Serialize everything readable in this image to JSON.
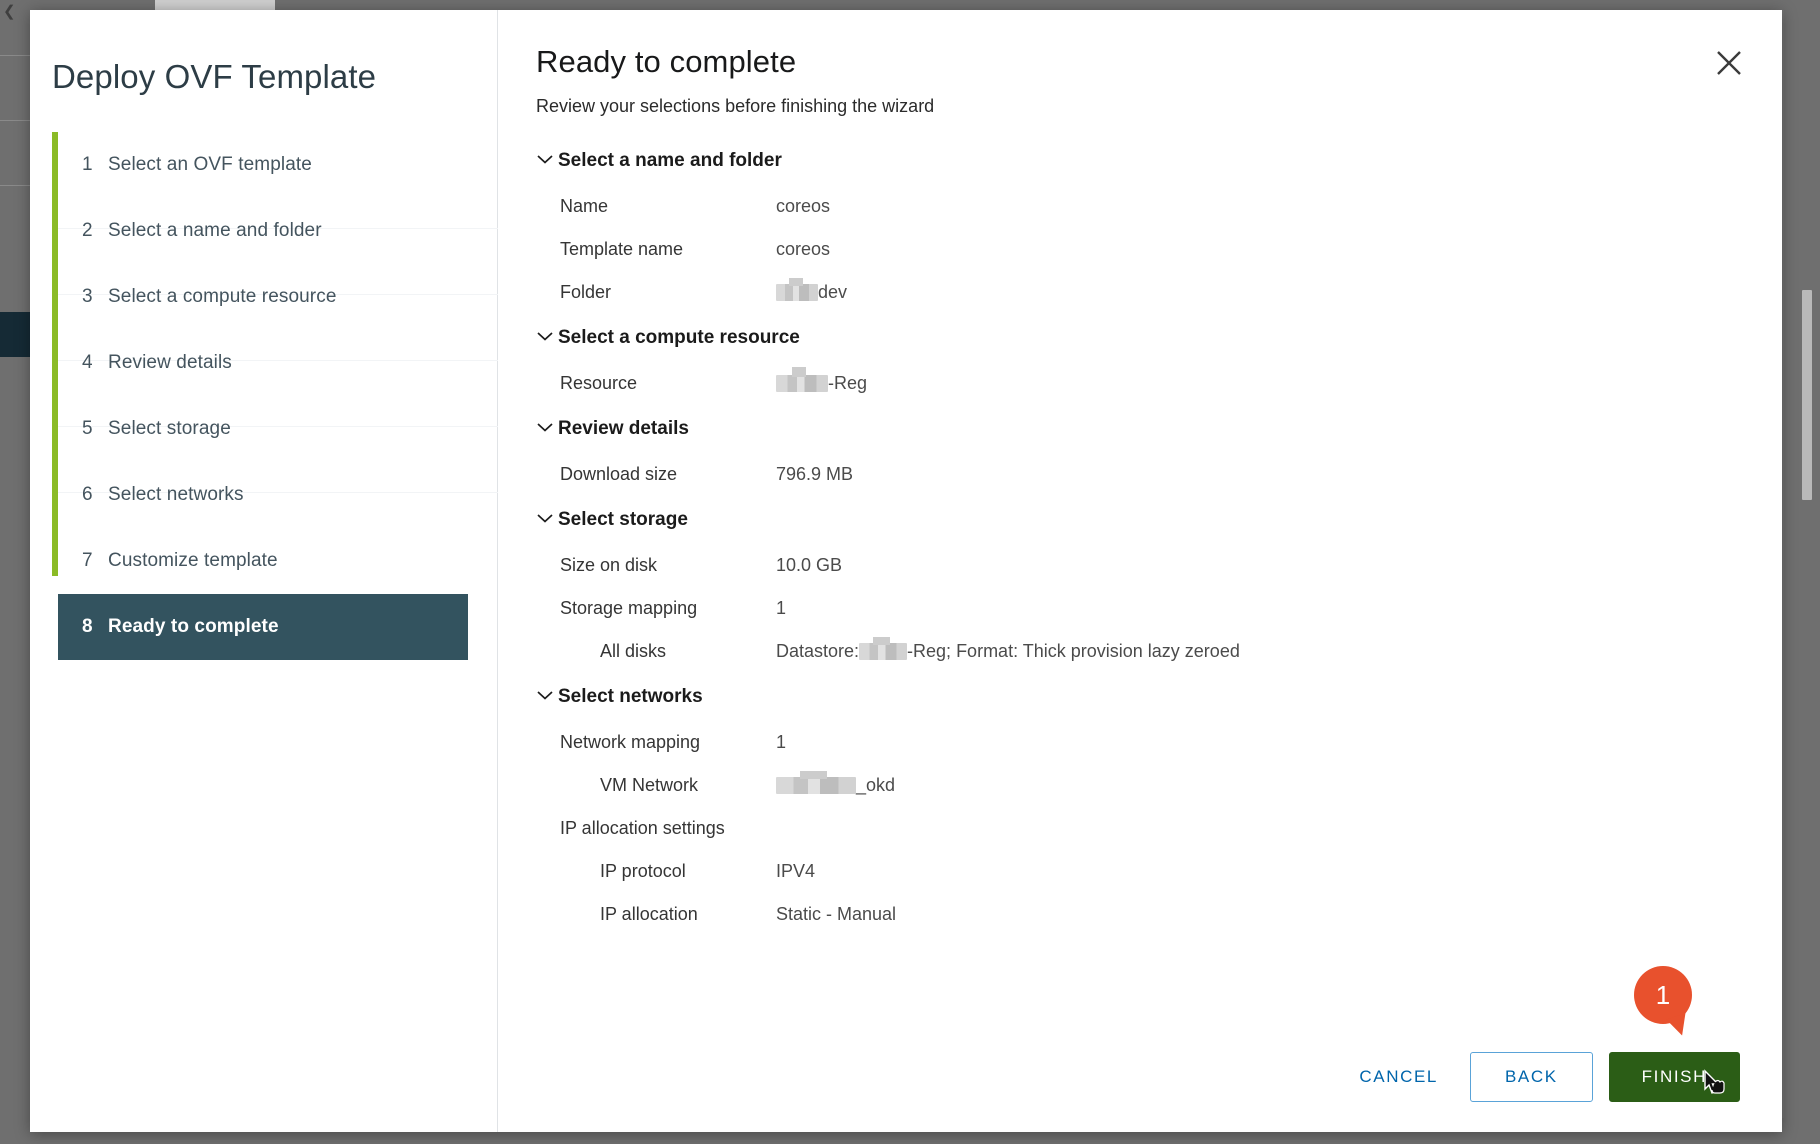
{
  "window": {
    "wizard_title": "Deploy OVF Template",
    "close_icon": "close-icon"
  },
  "sidebar": {
    "steps": [
      {
        "num": "1",
        "label": "Select an OVF template",
        "selected": false
      },
      {
        "num": "2",
        "label": "Select a name and folder",
        "selected": false
      },
      {
        "num": "3",
        "label": "Select a compute resource",
        "selected": false
      },
      {
        "num": "4",
        "label": "Review details",
        "selected": false
      },
      {
        "num": "5",
        "label": "Select storage",
        "selected": false
      },
      {
        "num": "6",
        "label": "Select networks",
        "selected": false
      },
      {
        "num": "7",
        "label": "Customize template",
        "selected": false
      },
      {
        "num": "8",
        "label": "Ready to complete",
        "selected": true
      }
    ],
    "accent_color": "#8bbb26",
    "selected_color": "#33535f"
  },
  "main": {
    "title": "Ready to complete",
    "subtitle": "Review your selections before finishing the wizard",
    "sections": [
      {
        "heading": "Select a name and folder",
        "rows": [
          {
            "key": "Name",
            "value": "coreos"
          },
          {
            "key": "Template name",
            "value": "coreos"
          },
          {
            "key": "Folder",
            "value": "dev",
            "redacted_prefix": true
          }
        ]
      },
      {
        "heading": "Select a compute resource",
        "rows": [
          {
            "key": "Resource",
            "value": "-Reg",
            "redacted_prefix": true
          }
        ]
      },
      {
        "heading": "Review details",
        "rows": [
          {
            "key": "Download size",
            "value": "796.9 MB"
          }
        ]
      },
      {
        "heading": "Select storage",
        "rows": [
          {
            "key": "Size on disk",
            "value": "10.0 GB"
          },
          {
            "key": "Storage mapping",
            "value": "1"
          },
          {
            "key": "All disks",
            "value_prefix": "Datastore:",
            "value": "-Reg; Format: Thick provision lazy zeroed",
            "redacted_mid": true,
            "indent": true
          }
        ]
      },
      {
        "heading": "Select networks",
        "rows": [
          {
            "key": "Network mapping",
            "value": "1"
          },
          {
            "key": "VM Network",
            "value": "_okd",
            "redacted_prefix": true,
            "indent": true
          },
          {
            "key": "IP allocation settings",
            "value": ""
          },
          {
            "key": "IP protocol",
            "value": "IPV4",
            "indent": true
          },
          {
            "key": "IP allocation",
            "value": "Static - Manual",
            "indent": true
          }
        ]
      }
    ]
  },
  "footer": {
    "cancel_label": "CANCEL",
    "back_label": "BACK",
    "finish_label": "FINISH",
    "finish_color": "#2b5d16",
    "link_color": "#0065ab"
  },
  "annotation": {
    "badge_number": "1",
    "badge_color": "#e8512d"
  }
}
